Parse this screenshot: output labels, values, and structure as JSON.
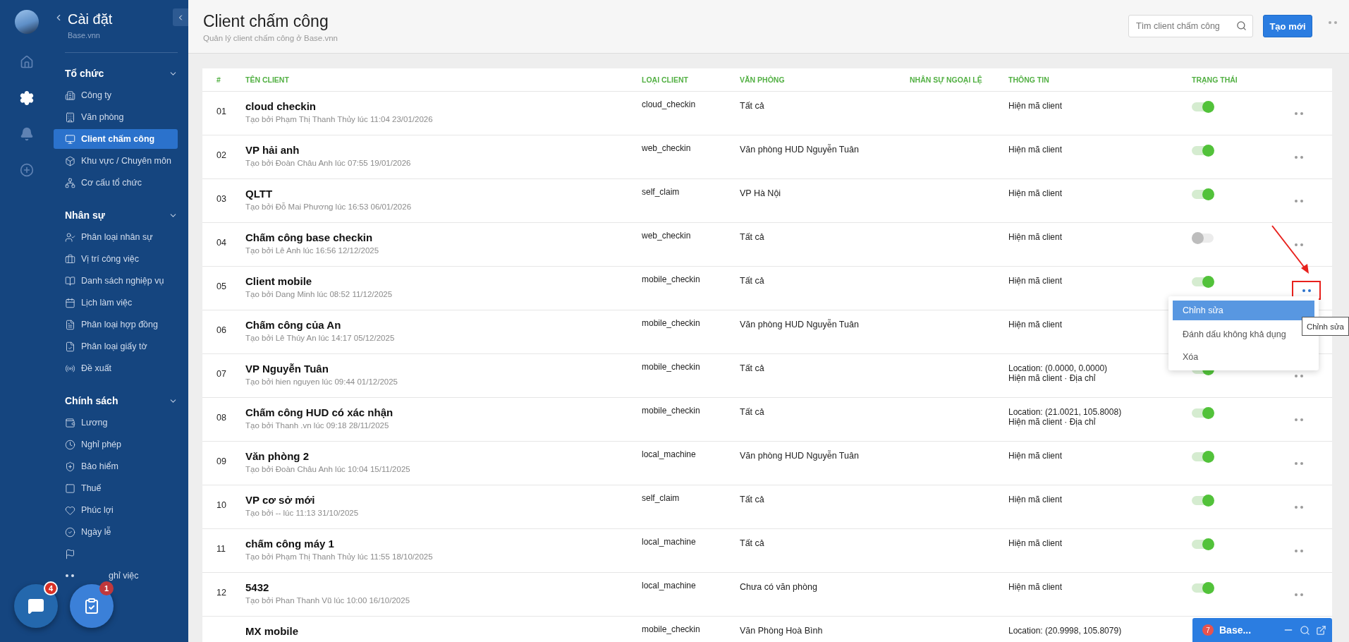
{
  "rail": {
    "items": [
      {
        "selected": false
      },
      {
        "selected": true
      },
      {
        "selected": false
      },
      {
        "selected": false
      }
    ]
  },
  "sidebar": {
    "title": "Cài đặt",
    "subtitle": "Base.vnn",
    "sections": [
      {
        "title": "Tổ chức",
        "expanded": true,
        "items": [
          {
            "label": "Công ty",
            "selected": false
          },
          {
            "label": "Văn phòng",
            "selected": false
          },
          {
            "label": "Client chấm công",
            "selected": true
          },
          {
            "label": "Khu vực / Chuyên môn",
            "selected": false
          },
          {
            "label": "Cơ cấu tổ chức",
            "selected": false
          }
        ]
      },
      {
        "title": "Nhân sự",
        "expanded": true,
        "items": [
          {
            "label": "Phân loại nhân sự",
            "selected": false
          },
          {
            "label": "Vị trí công việc",
            "selected": false
          },
          {
            "label": "Danh sách nghiệp vụ",
            "selected": false
          },
          {
            "label": "Lịch làm việc",
            "selected": false
          },
          {
            "label": "Phân loại hợp đồng",
            "selected": false
          },
          {
            "label": "Phân loại giấy tờ",
            "selected": false
          },
          {
            "label": "Đề xuất",
            "selected": false
          }
        ]
      },
      {
        "title": "Chính sách",
        "expanded": true,
        "items": [
          {
            "label": "Lương",
            "selected": false
          },
          {
            "label": "Nghỉ phép",
            "selected": false
          },
          {
            "label": "Bảo hiểm",
            "selected": false
          },
          {
            "label": "Thuế",
            "selected": false
          },
          {
            "label": "Phúc lợi",
            "selected": false
          },
          {
            "label": "Ngày lễ",
            "selected": false
          },
          {
            "selected": false
          },
          {
            "label": "ghỉ việc",
            "selected": false,
            "kind": "covered"
          }
        ]
      }
    ]
  },
  "header": {
    "title": "Client chấm công",
    "subtitle": "Quản lý client chấm công ở Base.vnn",
    "search": {
      "placeholder": "Tìm client chấm công"
    },
    "create_button": "Tạo mới"
  },
  "table": {
    "columns": [
      "#",
      "TÊN CLIENT",
      "LOẠI CLIENT",
      "VĂN PHÒNG",
      "NHÂN SỰ NGOẠI LỆ",
      "THÔNG TIN",
      "TRẠNG THÁI"
    ],
    "rows": [
      {
        "index": "01",
        "name": "cloud checkin",
        "created": "Tạo bởi Phạm Thị Thanh Thủy lúc 11:04 23/01/2026",
        "type": "cloud_checkin",
        "office": "Tất cả",
        "info": [
          "Hiện mã client"
        ],
        "on": true,
        "menu_open": false
      },
      {
        "index": "02",
        "name": "VP hải anh",
        "created": "Tạo bởi Đoàn Châu Anh lúc 07:55 19/01/2026",
        "type": "web_checkin",
        "office": "Văn phòng HUD Nguyễn Tuân",
        "info": [
          "Hiện mã client"
        ],
        "on": true,
        "menu_open": false
      },
      {
        "index": "03",
        "name": "QLTT",
        "created": "Tạo bởi Đỗ Mai Phương lúc 16:53 06/01/2026",
        "type": "self_claim",
        "office": "VP Hà Nội",
        "info": [
          "Hiện mã client"
        ],
        "on": true,
        "menu_open": false
      },
      {
        "index": "04",
        "name": "Chấm công base checkin",
        "created": "Tạo bởi Lê Anh lúc 16:56 12/12/2025",
        "type": "web_checkin",
        "office": "Tất cả",
        "info": [
          "Hiện mã client"
        ],
        "on": false,
        "menu_open": false
      },
      {
        "index": "05",
        "name": "Client mobile",
        "created": "Tạo bởi Dang Minh lúc 08:52 11/12/2025",
        "type": "mobile_checkin",
        "office": "Tất cả",
        "info": [
          "Hiện mã client"
        ],
        "on": true,
        "menu_open": true
      },
      {
        "index": "06",
        "name": "Chấm công của An",
        "created": "Tạo bởi Lê Thúy An lúc 14:17 05/12/2025",
        "type": "mobile_checkin",
        "office": "Văn phòng HUD Nguyễn Tuân",
        "info": [
          "Hiện mã client"
        ]
      },
      {
        "index": "07",
        "name": "VP Nguyễn Tuân",
        "created": "Tạo bởi hien nguyen lúc 09:44 01/12/2025",
        "type": "mobile_checkin",
        "office": "Tất cả",
        "info": [
          "Location: (0.0000, 0.0000)",
          "Hiện mã client · Địa chỉ"
        ],
        "on": true,
        "menu_open": false
      },
      {
        "index": "08",
        "name": "Chấm công HUD có xác nhận",
        "created": "Tạo bởi Thanh .vn lúc 09:18 28/11/2025",
        "type": "mobile_checkin",
        "office": "Tất cả",
        "info": [
          "Location: (21.0021, 105.8008)",
          "Hiện mã client · Địa chỉ"
        ],
        "on": true,
        "menu_open": false
      },
      {
        "index": "09",
        "name": "Văn phòng 2",
        "created": "Tạo bởi Đoàn Châu Anh lúc 10:04 15/11/2025",
        "type": "local_machine",
        "office": "Văn phòng HUD Nguyễn Tuân",
        "info": [
          "Hiện mã client"
        ],
        "on": true,
        "menu_open": false
      },
      {
        "index": "10",
        "name": "VP cơ sở mới",
        "created": "Tạo bởi -- lúc 11:13 31/10/2025",
        "type": "self_claim",
        "office": "Tất cả",
        "info": [
          "Hiện mã client"
        ],
        "on": true,
        "menu_open": false
      },
      {
        "index": "11",
        "name": "chấm công máy 1",
        "created": "Tạo bởi Phạm Thị Thanh Thủy lúc 11:55 18/10/2025",
        "type": "local_machine",
        "office": "Tất cả",
        "info": [
          "Hiện mã client"
        ],
        "on": true,
        "menu_open": false
      },
      {
        "index": "12",
        "name": "5432",
        "created": "Tạo bởi Phan Thanh Vũ lúc 10:00 16/10/2025",
        "type": "local_machine",
        "office": "Chưa có văn phòng",
        "info": [
          "Hiện mã client"
        ],
        "on": true,
        "menu_open": false
      },
      {
        "name": "MX mobile",
        "type": "mobile_checkin",
        "office": "Văn Phòng Hoà Bình",
        "info": [
          "Location: (20.9998, 105.8079)"
        ]
      }
    ]
  },
  "action_menu": {
    "items": [
      {
        "label": "Chỉnh sửa",
        "selected": true
      },
      {
        "label": "Đánh dấu không khả dụng",
        "selected": false
      },
      {
        "label": "Xóa",
        "selected": false
      }
    ],
    "tooltip": "Chỉnh sửa"
  },
  "floating_buttons": [
    {
      "badge": "4"
    },
    {
      "badge": "1"
    }
  ],
  "chat_widget": {
    "badge": "7",
    "title": "Base..."
  }
}
